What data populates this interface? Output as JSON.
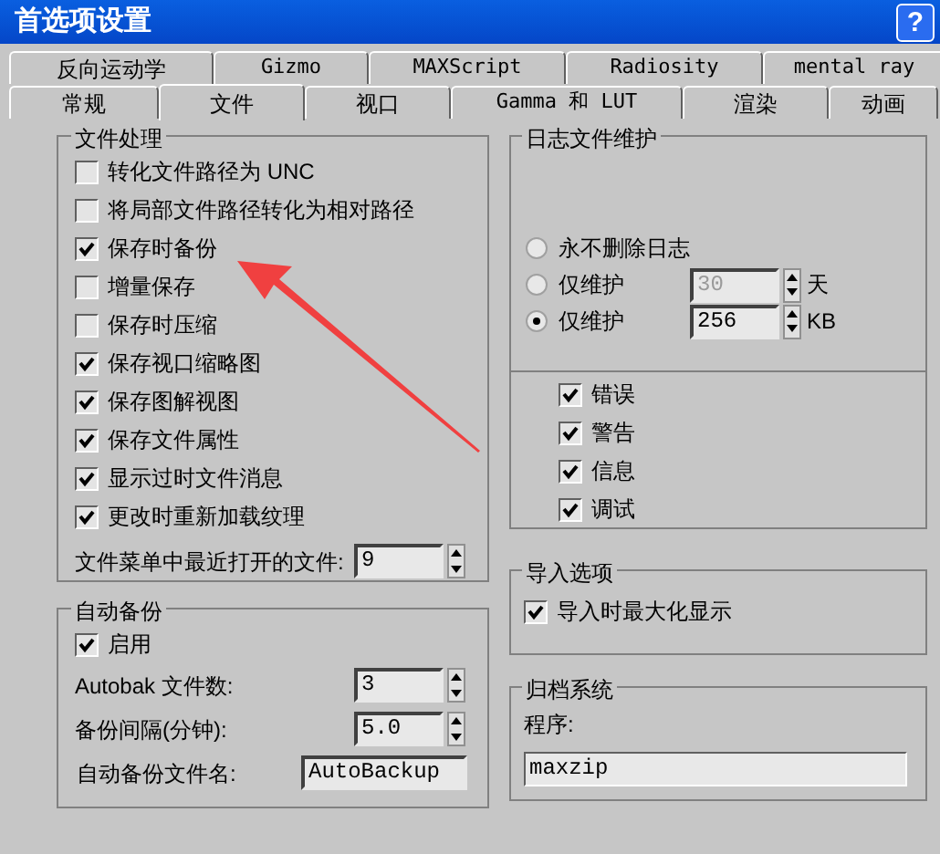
{
  "window": {
    "title": "首选项设置",
    "help_button": "?"
  },
  "tab_rows": [
    [
      {
        "label": "反向运动学",
        "selected": false
      },
      {
        "label": "Gizmo",
        "selected": false
      },
      {
        "label": "MAXScript",
        "selected": false
      },
      {
        "label": "Radiosity",
        "selected": false
      },
      {
        "label": "mental ray",
        "selected": false
      }
    ],
    [
      {
        "label": "常规",
        "selected": false
      },
      {
        "label": "文件",
        "selected": true
      },
      {
        "label": "视口",
        "selected": false
      },
      {
        "label": "Gamma 和 LUT",
        "selected": false
      },
      {
        "label": "渲染",
        "selected": false
      },
      {
        "label": "动画",
        "selected": false
      }
    ]
  ],
  "file_handling": {
    "title": "文件处理",
    "options": [
      {
        "label": "转化文件路径为 UNC",
        "checked": false
      },
      {
        "label": "将局部文件路径转化为相对路径",
        "checked": false
      },
      {
        "label": "保存时备份",
        "checked": true
      },
      {
        "label": "增量保存",
        "checked": false
      },
      {
        "label": "保存时压缩",
        "checked": false
      },
      {
        "label": "保存视口缩略图",
        "checked": true
      },
      {
        "label": "保存图解视图",
        "checked": true
      },
      {
        "label": "保存文件属性",
        "checked": true
      },
      {
        "label": "显示过时文件消息",
        "checked": true
      },
      {
        "label": "更改时重新加载纹理",
        "checked": true
      }
    ],
    "recent_files": {
      "label": "文件菜单中最近打开的文件:",
      "value": "9"
    }
  },
  "auto_backup": {
    "title": "自动备份",
    "enable": {
      "label": "启用",
      "checked": true
    },
    "fields": [
      {
        "kind": "spinner",
        "label": "Autobak 文件数:",
        "value": "3"
      },
      {
        "kind": "spinner",
        "label": "备份间隔(分钟):",
        "value": "5.0"
      },
      {
        "kind": "text",
        "label": "自动备份文件名:",
        "value": "AutoBackup"
      }
    ]
  },
  "log_maintenance": {
    "title": "日志文件维护",
    "retention": [
      {
        "label": "永不删除日志",
        "selected": false
      },
      {
        "label": "仅维护",
        "selected": false,
        "value": "30",
        "unit": "天",
        "disabled": true
      },
      {
        "label": "仅维护",
        "selected": true,
        "value": "256",
        "unit": "KB",
        "disabled": false
      }
    ],
    "levels": [
      {
        "label": "错误",
        "checked": true
      },
      {
        "label": "警告",
        "checked": true
      },
      {
        "label": "信息",
        "checked": true
      },
      {
        "label": "调试",
        "checked": true
      }
    ]
  },
  "import_options": {
    "title": "导入选项",
    "options": [
      {
        "label": "导入时最大化显示",
        "checked": true
      }
    ]
  },
  "archive": {
    "title": "归档系统",
    "program_label": "程序:",
    "program_value": "maxzip"
  }
}
